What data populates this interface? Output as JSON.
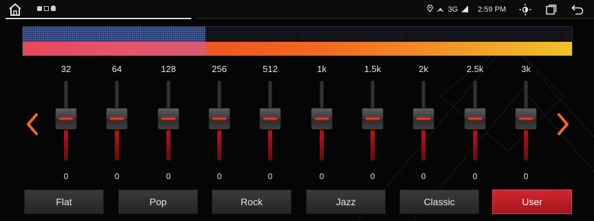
{
  "status_bar": {
    "network": "3G",
    "time": "2:59 PM"
  },
  "bands": [
    {
      "label": "32",
      "value": "0"
    },
    {
      "label": "64",
      "value": "0"
    },
    {
      "label": "128",
      "value": "0"
    },
    {
      "label": "256",
      "value": "0"
    },
    {
      "label": "512",
      "value": "0"
    },
    {
      "label": "1k",
      "value": "0"
    },
    {
      "label": "1.5k",
      "value": "0"
    },
    {
      "label": "2k",
      "value": "0"
    },
    {
      "label": "2.5k",
      "value": "0"
    },
    {
      "label": "3k",
      "value": "0"
    }
  ],
  "presets": [
    {
      "label": "Flat",
      "active": false
    },
    {
      "label": "Pop",
      "active": false
    },
    {
      "label": "Rock",
      "active": false
    },
    {
      "label": "Jazz",
      "active": false
    },
    {
      "label": "Classic",
      "active": false
    },
    {
      "label": "User",
      "active": true
    }
  ],
  "icons": {
    "home": "home-icon",
    "location": "location-icon",
    "hotspot": "hotspot-icon",
    "signal": "signal-icon",
    "brightness": "brightness-icon",
    "windows": "recent-apps-icon",
    "back": "back-icon",
    "prev": "chevron-left-icon",
    "next": "chevron-right-icon"
  },
  "colors": {
    "accent_red": "#c8222b",
    "arrow_orange": "#f26a22",
    "knob_line": "#ff3a22"
  }
}
